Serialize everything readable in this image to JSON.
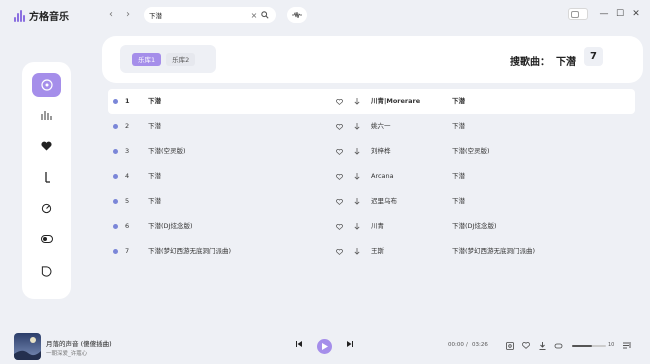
{
  "app": {
    "name": "方格音乐"
  },
  "nav": {
    "back": "‹",
    "forward": "›"
  },
  "search": {
    "value": "下潜",
    "placeholder": ""
  },
  "window": {
    "minimize": "—",
    "maximize": "☐",
    "close": "✕"
  },
  "tabs": [
    {
      "label": "乐库1",
      "active": true
    },
    {
      "label": "乐库2",
      "active": false
    }
  ],
  "header": {
    "label": "搜歌曲：",
    "query": "下潜",
    "count": "7"
  },
  "songs": [
    {
      "index": "1",
      "title": "下潜",
      "artist": "川青|Morerare",
      "album": "下潜"
    },
    {
      "index": "2",
      "title": "下潜",
      "artist": "姚六一",
      "album": "下潜"
    },
    {
      "index": "3",
      "title": "下潜(空灵版)",
      "artist": "刘梓桦",
      "album": "下潜(空灵版)"
    },
    {
      "index": "4",
      "title": "下潜",
      "artist": "Arcana",
      "album": "下潜"
    },
    {
      "index": "5",
      "title": "下潜",
      "artist": "迟里乌布",
      "album": "下潜"
    },
    {
      "index": "6",
      "title": "下潜(DJ炫念版)",
      "artist": "川青",
      "album": "下潜(DJ炫念版)"
    },
    {
      "index": "7",
      "title": "下潜(梦幻西游无底洞门派曲)",
      "artist": "王斯",
      "album": "下潜(梦幻西游无底洞门派曲)"
    }
  ],
  "player": {
    "title": "月落的声音 (傻傻插曲)",
    "artist": "一朝深爱_许蔻心",
    "current_time": "00:00",
    "separator": "/",
    "total_time": "03:26",
    "volume_label": "10",
    "volume": 0.6,
    "prev": "◀",
    "next": "▶"
  },
  "colors": {
    "accent": "#a58eea",
    "background": "#eef0f5",
    "dot": "#7a86d8"
  },
  "icons": [
    "music-disc-icon",
    "bars-icon",
    "heart-icon",
    "download-icon",
    "compass-icon",
    "toggle-icon",
    "chat-icon"
  ]
}
